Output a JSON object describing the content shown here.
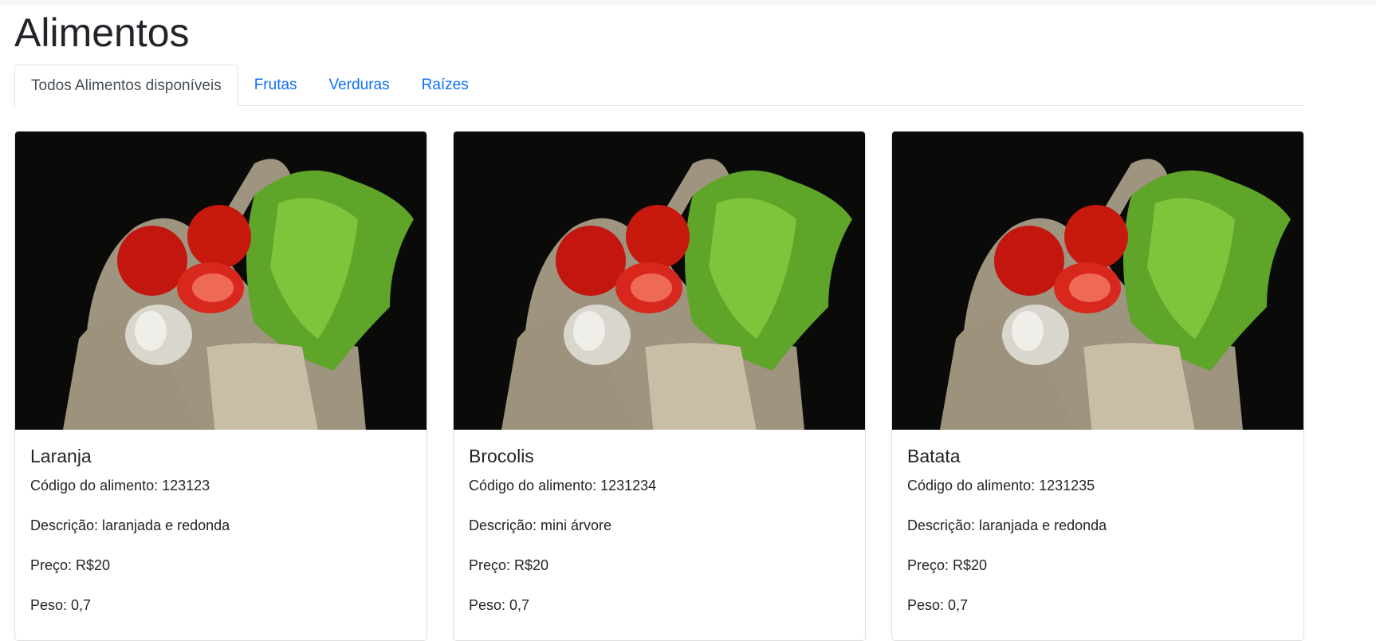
{
  "page": {
    "title": "Alimentos"
  },
  "tabs": [
    {
      "label": "Todos Alimentos disponíveis",
      "active": true
    },
    {
      "label": "Frutas"
    },
    {
      "label": "Verduras"
    },
    {
      "label": "Raízes"
    }
  ],
  "cards": [
    {
      "name": "Laranja",
      "code": "Código do alimento: 123123",
      "description": "Descrição: laranjada e redonda",
      "price": "Preço: R$20",
      "weight": "Peso: 0,7"
    },
    {
      "name": "Brocolis",
      "code": "Código do alimento: 1231234",
      "description": "Descrição: mini árvore",
      "price": "Preço: R$20",
      "weight": "Peso: 0,7"
    },
    {
      "name": "Batata",
      "code": "Código do alimento: 1231235",
      "description": "Descrição: laranjada e redonda",
      "price": "Preço: R$20",
      "weight": "Peso: 0,7"
    }
  ],
  "colors": {
    "link": "#0d6efd",
    "text": "#212529",
    "image_bg": "#0a0b09"
  }
}
